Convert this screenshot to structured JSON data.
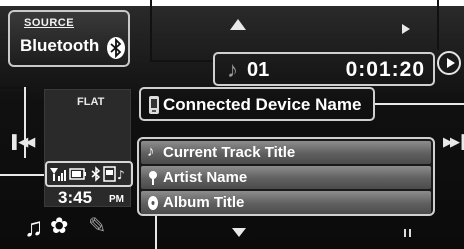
{
  "source": {
    "label": "SOURCE",
    "value": "Bluetooth"
  },
  "playback": {
    "track_number": "01",
    "elapsed_time": "0:01:20"
  },
  "device": {
    "name": "Connected Device Name"
  },
  "equalizer": {
    "preset": "FLAT"
  },
  "clock": {
    "time": "3:45",
    "period": "PM"
  },
  "track_info": {
    "title": "Current Track Title",
    "artist": "Artist Name",
    "album": "Album Title"
  },
  "icons": {
    "bluetooth": "bluetooth-icon",
    "note": "music-note-icon",
    "phone": "phone-icon",
    "signal": "signal-icon",
    "battery": "battery-icon",
    "artist": "person-icon",
    "album": "disc-icon",
    "menu": "music-settings-icon",
    "edit": "pen-icon"
  },
  "colors": {
    "background": "#0b0b0b",
    "text": "#ffffff",
    "border": "#cfcfcf",
    "row": "#6a6a6a"
  }
}
